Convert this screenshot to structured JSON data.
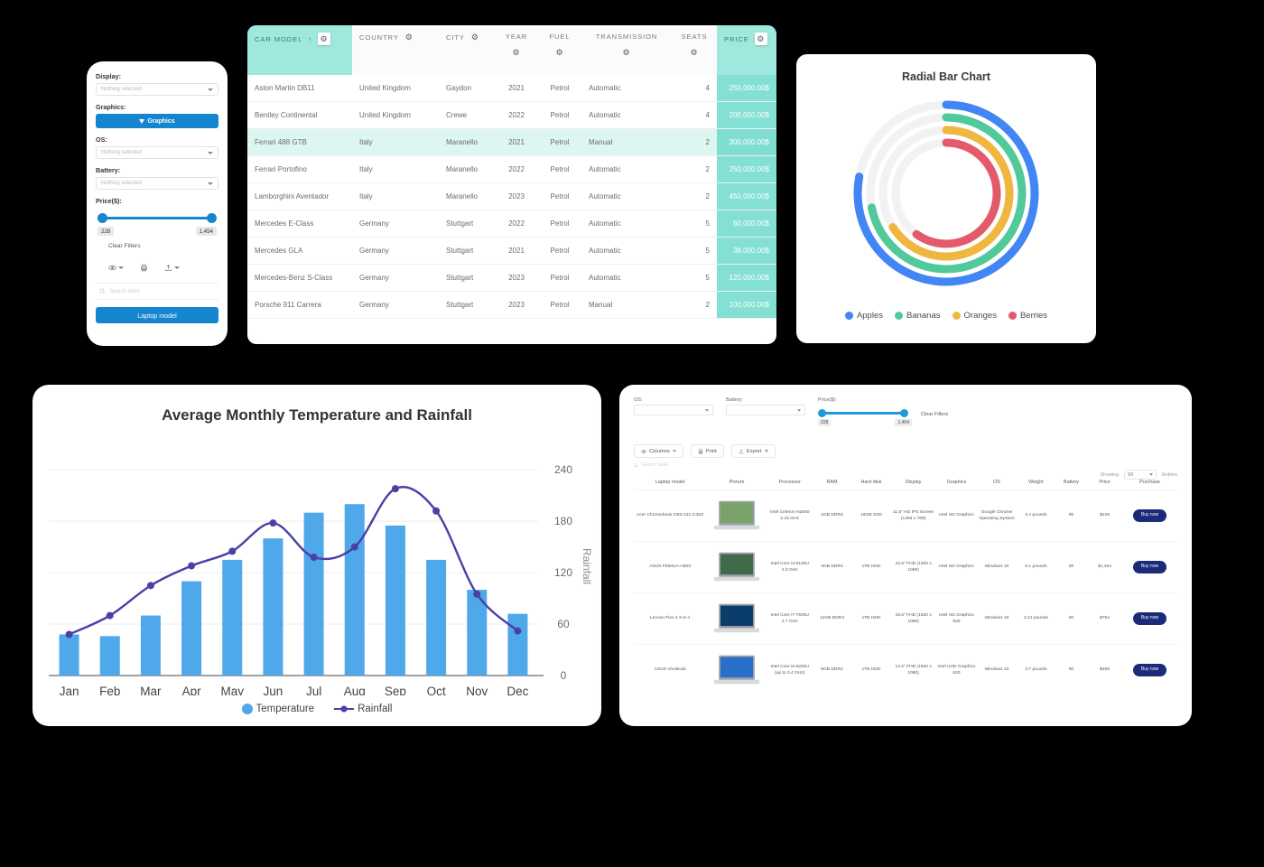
{
  "phone_panel": {
    "display_label": "Display:",
    "display_value": "Nothing selected",
    "graphics_label": "Graphics:",
    "graphics_button": "Graphics",
    "os_label": "OS:",
    "os_value": "Nothing selected",
    "battery_label": "Battery:",
    "battery_value": "Nothing selected",
    "price_label": "Price($):",
    "price_min": "228",
    "price_max": "1,454",
    "clear_filters": "Clear Filters",
    "search_placeholder": "Search table",
    "cta": "Laptop model"
  },
  "car_table": {
    "headers": [
      {
        "label": "CAR MODEL",
        "sorted": "↑",
        "highlight": true
      },
      {
        "label": "COUNTRY",
        "highlight": false
      },
      {
        "label": "CITY",
        "highlight": false
      },
      {
        "label": "YEAR",
        "highlight": false
      },
      {
        "label": "FUEL",
        "highlight": false
      },
      {
        "label": "TRANSMISSION",
        "highlight": false
      },
      {
        "label": "SEATS",
        "highlight": false
      },
      {
        "label": "PRICE",
        "highlight": true
      }
    ],
    "rows": [
      {
        "model": "Aston Martin DB11",
        "country": "United Kingdom",
        "city": "Gaydon",
        "year": "2021",
        "fuel": "Petrol",
        "transmission": "Automatic",
        "seats": "4",
        "price": "250,000.00$",
        "selected": false
      },
      {
        "model": "Bentley Continental",
        "country": "United Kingdom",
        "city": "Crewe",
        "year": "2022",
        "fuel": "Petrol",
        "transmission": "Automatic",
        "seats": "4",
        "price": "200,000.00$",
        "selected": false
      },
      {
        "model": "Ferrari 488 GTB",
        "country": "Italy",
        "city": "Maranello",
        "year": "2021",
        "fuel": "Petrol",
        "transmission": "Manual",
        "seats": "2",
        "price": "300,000.00$",
        "selected": true
      },
      {
        "model": "Ferrari Portofino",
        "country": "Italy",
        "city": "Maranello",
        "year": "2022",
        "fuel": "Petrol",
        "transmission": "Automatic",
        "seats": "2",
        "price": "250,000.00$",
        "selected": false
      },
      {
        "model": "Lamborghini Aventador",
        "country": "Italy",
        "city": "Maranello",
        "year": "2023",
        "fuel": "Petrol",
        "transmission": "Automatic",
        "seats": "2",
        "price": "450,000.00$",
        "selected": false
      },
      {
        "model": "Mercedes E-Class",
        "country": "Germany",
        "city": "Stuttgart",
        "year": "2022",
        "fuel": "Petrol",
        "transmission": "Automatic",
        "seats": "5",
        "price": "60,000.00$",
        "selected": false
      },
      {
        "model": "Mercedes GLA",
        "country": "Germany",
        "city": "Stuttgart",
        "year": "2021",
        "fuel": "Petrol",
        "transmission": "Automatic",
        "seats": "5",
        "price": "38,000.00$",
        "selected": false
      },
      {
        "model": "Mercedes-Benz S-Class",
        "country": "Germany",
        "city": "Stuttgart",
        "year": "2023",
        "fuel": "Petrol",
        "transmission": "Automatic",
        "seats": "5",
        "price": "120,000.00$",
        "selected": false
      },
      {
        "model": "Porsche 911 Carrera",
        "country": "Germany",
        "city": "Stuttgart",
        "year": "2023",
        "fuel": "Petrol",
        "transmission": "Manual",
        "seats": "2",
        "price": "100,000.00$",
        "selected": false
      }
    ]
  },
  "laptop_panel": {
    "os_label": "OS:",
    "battery_label": "Battery:",
    "price_label": "Price($):",
    "price_min": "228",
    "price_max": "1,454",
    "clear_filters": "Clear Filters",
    "toolbar": [
      {
        "label": "Columns",
        "icon": "eye-icon"
      },
      {
        "label": "Print",
        "icon": "printer-icon"
      },
      {
        "label": "Export",
        "icon": "export-icon"
      }
    ],
    "search_placeholder": "Search table",
    "showing_prefix": "Showing",
    "showing_value": "50",
    "showing_suffix": "Entries",
    "headers": [
      "Laptop model",
      "Picture",
      "Processor",
      "RAM",
      "Hard disk",
      "Display",
      "Graphics",
      "OS",
      "Weight",
      "Battery",
      "Price",
      "Purchase"
    ],
    "rows": [
      {
        "model": "Acer Chromebook CB3-131-C3SZ",
        "processor": "Intel Celeron N2840 2.16 GHz",
        "ram": "2GB DDR3",
        "disk": "16GB SSD",
        "display": "11.6\" HD IPS Screen (1366 x 768)",
        "graphics": "Intel HD Graphics",
        "os": "Google Chrome Operating System",
        "weight": "2.4 pounds",
        "battery": "9h",
        "price": "$228",
        "purchase": "Buy now"
      },
      {
        "model": "ASUS F556UA-AB32",
        "processor": "Intel Core i3-6100U 2.3 GHz",
        "ram": "4GB DDR4",
        "disk": "1TB HDD",
        "display": "15.6\" FHD (1920 x 1080)",
        "graphics": "Intel HD Graphics",
        "os": "Windows 10",
        "weight": "5.1 pounds",
        "battery": "5h",
        "price": "$1,454",
        "purchase": "Buy now"
      },
      {
        "model": "Lenovo Flex 4 2-in-1",
        "processor": "Intel Core i7-7500U 2.7 GHz",
        "ram": "12GB DDR4",
        "disk": "1TB HDD",
        "display": "15.6\" FHD (1920 x 1080)",
        "graphics": "Intel HD Graphics 620",
        "os": "Windows 10",
        "weight": "4.21 pounds",
        "battery": "6h",
        "price": "$754",
        "purchase": "Buy now"
      },
      {
        "model": "ASUS VivoBook",
        "processor": "Intel Core i5-8250U (up to 3.4 GHz)",
        "ram": "8GB DDR4",
        "disk": "1TB HDD",
        "display": "14.2\" FHD (1920 x 1080)",
        "graphics": "Intel UHD Graphics 620",
        "os": "Windows 10",
        "weight": "3.7 pounds",
        "battery": "5h",
        "price": "$499",
        "purchase": "Buy now"
      }
    ]
  },
  "chart_data": [
    {
      "type": "bar",
      "id": "radial-bar-chart",
      "title": "Radial Bar Chart",
      "categories": [
        "Apples",
        "Bananas",
        "Oranges",
        "Berries"
      ],
      "values": [
        78,
        72,
        66,
        60
      ],
      "colors": [
        "#4285f4",
        "#52c99a",
        "#f0b740",
        "#e35b6a"
      ],
      "track_color": "#f2f2f2",
      "legend_position": "bottom",
      "units": "percent of full circle"
    },
    {
      "type": "bar",
      "id": "temperature-rainfall-chart",
      "title": "Average Monthly Temperature and Rainfall",
      "categories": [
        "Jan",
        "Feb",
        "Mar",
        "Apr",
        "May",
        "Jun",
        "Jul",
        "Aug",
        "Sep",
        "Oct",
        "Nov",
        "Dec"
      ],
      "series": [
        {
          "name": "Temperature",
          "type": "bar",
          "color": "#4fa8ea",
          "values": [
            48,
            46,
            70,
            110,
            135,
            160,
            190,
            200,
            175,
            135,
            100,
            72
          ]
        },
        {
          "name": "Rainfall",
          "type": "line",
          "color": "#4b3fa8",
          "values": [
            48,
            70,
            105,
            128,
            145,
            178,
            138,
            150,
            218,
            192,
            95,
            52
          ]
        }
      ],
      "ylabel": "Rainfall",
      "xlabel": "",
      "yticks": [
        0,
        60,
        120,
        180,
        240
      ],
      "ylim": [
        0,
        255
      ],
      "grid": true,
      "legend_position": "bottom"
    }
  ]
}
